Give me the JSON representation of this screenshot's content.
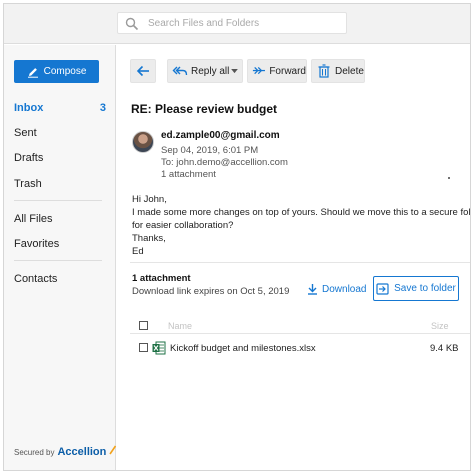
{
  "search": {
    "placeholder": "Search Files and Folders"
  },
  "sidebar": {
    "compose_label": "Compose",
    "items": [
      {
        "label": "Inbox",
        "count": "3"
      },
      {
        "label": "Sent"
      },
      {
        "label": "Drafts"
      },
      {
        "label": "Trash"
      },
      {
        "label": "All Files"
      },
      {
        "label": "Favorites"
      },
      {
        "label": "Contacts"
      }
    ],
    "secured_by": "Secured by",
    "brand": "Accellion"
  },
  "toolbar": {
    "reply_all_label": "Reply all",
    "forward_label": "Forward",
    "delete_label": "Delete"
  },
  "message": {
    "subject": "RE: Please review budget",
    "from": "ed.zample00@gmail.com",
    "date": "Sep 04, 2019, 6:01 PM",
    "to": "To: john.demo@accellion.com",
    "attachment_count": "1 attachment",
    "body": [
      "Hi John,",
      "I made some more changes on top of yours. Should we move this to a secure folder",
      "for easier collaboration?",
      "Thanks,",
      "Ed"
    ]
  },
  "attachments": {
    "title": "1 attachment",
    "expires": "Download link expires on Oct 5, 2019",
    "download_label": "Download",
    "save_label": "Save to folder",
    "columns": {
      "name": "Name",
      "size": "Size"
    },
    "files": [
      {
        "name": "Kickoff budget and milestones.xlsx",
        "size": "9.4 KB",
        "type_icon": "excel-icon"
      }
    ]
  },
  "colors": {
    "accent": "#1577d1",
    "excel_green": "#1e7145"
  }
}
